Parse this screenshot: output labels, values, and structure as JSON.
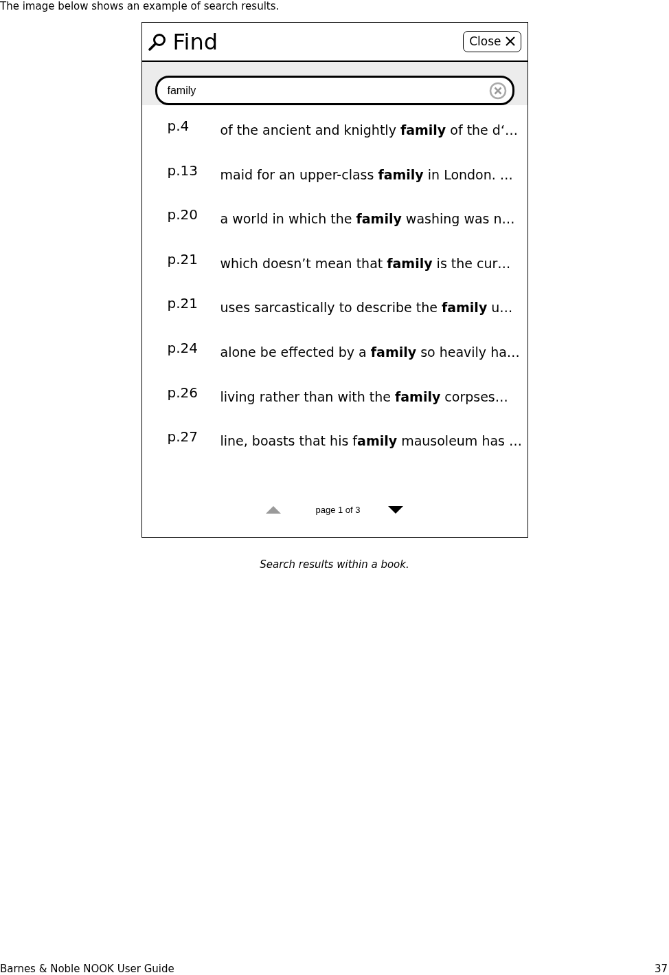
{
  "intro": "The image below shows an example of search results.",
  "screen": {
    "title": "Find",
    "close_button": "Close",
    "search": {
      "value": "family"
    },
    "results": [
      {
        "page": "p.4",
        "snippet": "of the ancient and knightly **family** of the d‘…"
      },
      {
        "page": "p.13",
        "snippet": "maid for an upper-class **family** in London. …"
      },
      {
        "page": "p.20",
        "snippet": "a world in which the **family** washing was n…"
      },
      {
        "page": "p.21",
        "snippet": "which doesn’t mean that **family** is the cur…"
      },
      {
        "page": "p.21",
        "snippet": "uses sarcastically to describe the **family** u…"
      },
      {
        "page": "p.24",
        "snippet": "alone be effected by a **family** so heavily ha…"
      },
      {
        "page": "p.26",
        "snippet": "living rather than with the **family** corpses…"
      },
      {
        "page": "p.27",
        "snippet": "line, boasts that his f**amily** mausoleum has …"
      }
    ],
    "pager": {
      "label": "page 1 of 3",
      "previous_disabled": true,
      "next_disabled": false
    }
  },
  "caption": "Search results within a book.",
  "footer": {
    "title": "Barnes & Noble NOOK User Guide",
    "page_number": "37"
  }
}
